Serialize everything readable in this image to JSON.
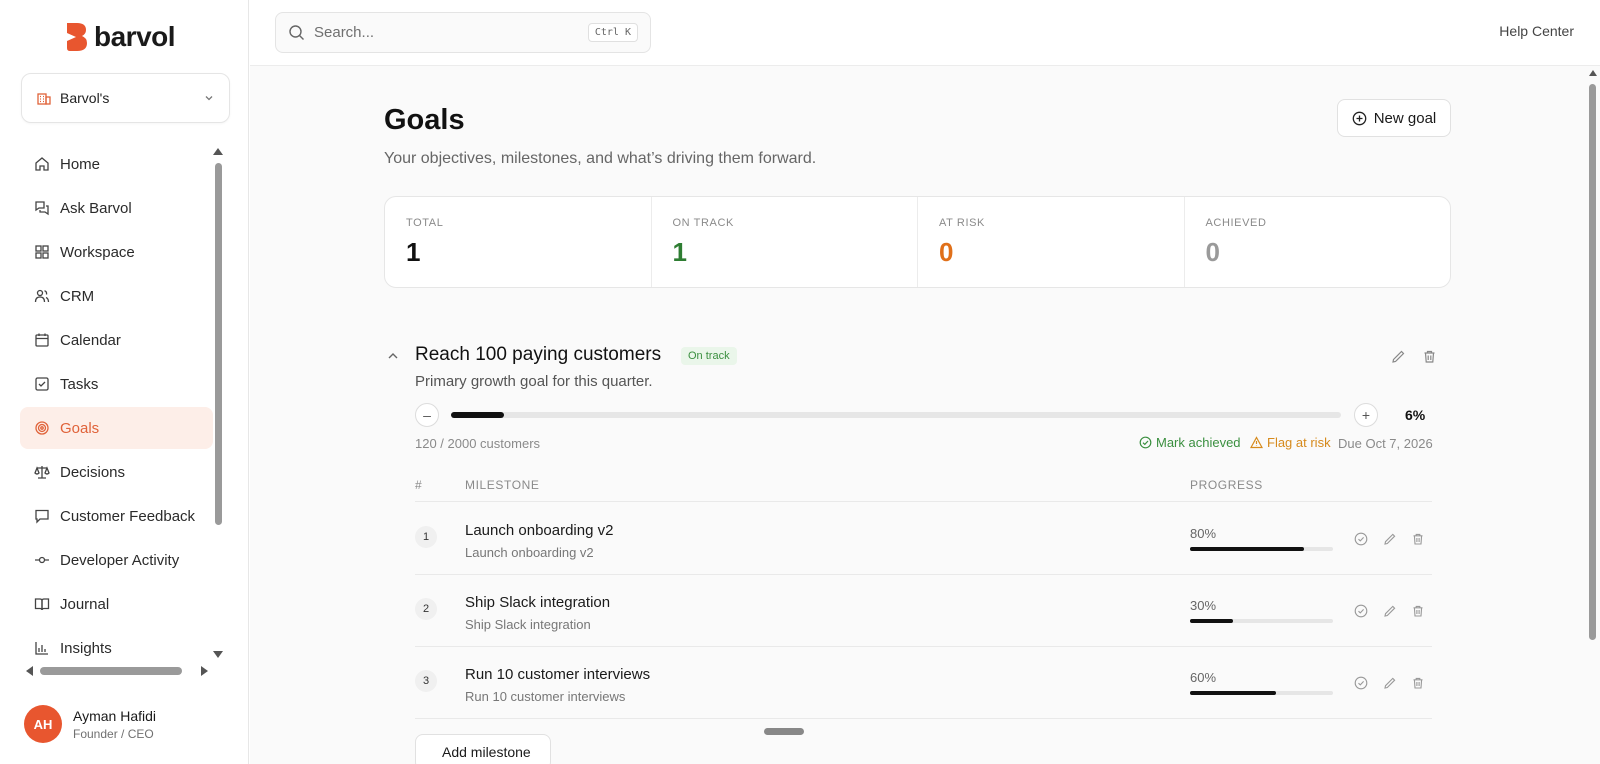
{
  "brand": {
    "name": "barvol",
    "accent": "#e0633a"
  },
  "workspace": {
    "label": "Barvol's"
  },
  "sidebar": {
    "items": [
      {
        "label": "Home",
        "icon": "home-icon"
      },
      {
        "label": "Ask Barvol",
        "icon": "chat-icon"
      },
      {
        "label": "Workspace",
        "icon": "grid-icon"
      },
      {
        "label": "CRM",
        "icon": "users-icon"
      },
      {
        "label": "Calendar",
        "icon": "calendar-icon"
      },
      {
        "label": "Tasks",
        "icon": "checkbox-icon"
      },
      {
        "label": "Goals",
        "icon": "target-icon",
        "active": true
      },
      {
        "label": "Decisions",
        "icon": "scale-icon"
      },
      {
        "label": "Customer Feedback",
        "icon": "message-square-icon"
      },
      {
        "label": "Developer Activity",
        "icon": "commit-icon"
      },
      {
        "label": "Journal",
        "icon": "book-icon"
      },
      {
        "label": "Insights",
        "icon": "bar-chart-icon"
      }
    ]
  },
  "user": {
    "initials": "AH",
    "name": "Ayman Hafidi",
    "role": "Founder / CEO",
    "avatar_color": "#e8562f"
  },
  "search": {
    "placeholder": "Search...",
    "shortcut": "Ctrl K"
  },
  "header": {
    "help": "Help Center"
  },
  "page": {
    "title": "Goals",
    "subtitle": "Your objectives, milestones, and what’s driving them forward.",
    "new_goal_label": "New goal"
  },
  "stats": [
    {
      "label": "TOTAL",
      "value": "1",
      "color": "#111111"
    },
    {
      "label": "ON TRACK",
      "value": "1",
      "color": "#2e7d32"
    },
    {
      "label": "AT RISK",
      "value": "0",
      "color": "#e0701a"
    },
    {
      "label": "ACHIEVED",
      "value": "0",
      "color": "#9a9a9a"
    }
  ],
  "goal": {
    "title": "Reach 100 paying customers",
    "status": "On track",
    "description": "Primary growth goal for this quarter.",
    "progress": 6,
    "progress_label": "6%",
    "count_text": "120 / 2000 customers",
    "mark_achieved": "Mark achieved",
    "flag_at_risk": "Flag at risk",
    "due": "Due Oct 7, 2026",
    "milestone_headers": {
      "num": "#",
      "milestone": "MILESTONE",
      "progress": "PROGRESS"
    },
    "milestones": [
      {
        "num": "1",
        "title": "Launch onboarding v2",
        "sub": "Launch onboarding v2",
        "progress": 80,
        "progress_label": "80%"
      },
      {
        "num": "2",
        "title": "Ship Slack integration",
        "sub": "Ship Slack integration",
        "progress": 30,
        "progress_label": "30%"
      },
      {
        "num": "3",
        "title": "Run 10 customer interviews",
        "sub": "Run 10 customer interviews",
        "progress": 60,
        "progress_label": "60%"
      }
    ],
    "add_milestone": "Add milestone"
  }
}
